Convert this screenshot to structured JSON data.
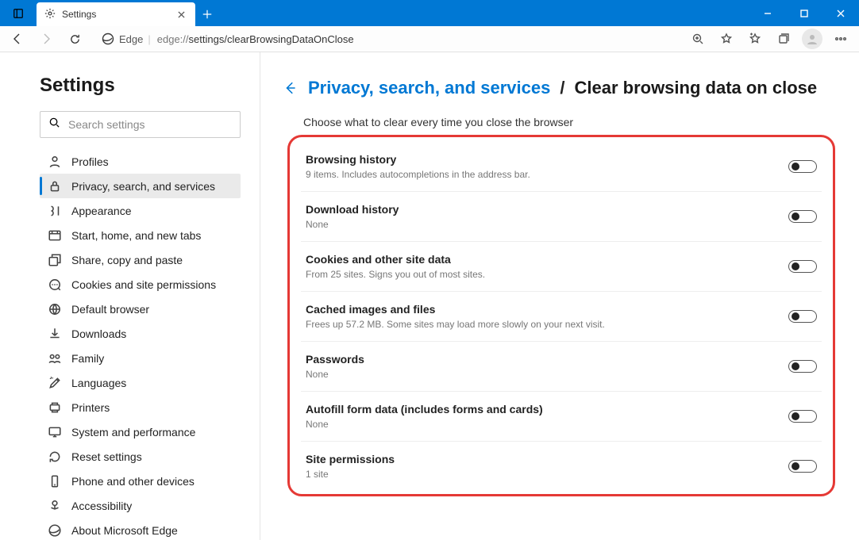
{
  "window": {
    "tab_title": "Settings"
  },
  "address": {
    "provider": "Edge",
    "url_prefix": "edge://",
    "url_path": "settings/clearBrowsingDataOnClose"
  },
  "sidebar": {
    "title": "Settings",
    "search_placeholder": "Search settings",
    "items": [
      {
        "label": "Profiles"
      },
      {
        "label": "Privacy, search, and services"
      },
      {
        "label": "Appearance"
      },
      {
        "label": "Start, home, and new tabs"
      },
      {
        "label": "Share, copy and paste"
      },
      {
        "label": "Cookies and site permissions"
      },
      {
        "label": "Default browser"
      },
      {
        "label": "Downloads"
      },
      {
        "label": "Family"
      },
      {
        "label": "Languages"
      },
      {
        "label": "Printers"
      },
      {
        "label": "System and performance"
      },
      {
        "label": "Reset settings"
      },
      {
        "label": "Phone and other devices"
      },
      {
        "label": "Accessibility"
      },
      {
        "label": "About Microsoft Edge"
      }
    ],
    "active_index": 1
  },
  "content": {
    "crumb_link": "Privacy, search, and services",
    "crumb_sep": "/",
    "crumb_current": "Clear browsing data on close",
    "subtitle": "Choose what to clear every time you close the browser",
    "options": [
      {
        "title": "Browsing history",
        "desc": "9 items. Includes autocompletions in the address bar.",
        "on": false
      },
      {
        "title": "Download history",
        "desc": "None",
        "on": false
      },
      {
        "title": "Cookies and other site data",
        "desc": "From 25 sites. Signs you out of most sites.",
        "on": false
      },
      {
        "title": "Cached images and files",
        "desc": "Frees up 57.2 MB. Some sites may load more slowly on your next visit.",
        "on": false
      },
      {
        "title": "Passwords",
        "desc": "None",
        "on": false
      },
      {
        "title": "Autofill form data (includes forms and cards)",
        "desc": "None",
        "on": false
      },
      {
        "title": "Site permissions",
        "desc": "1 site",
        "on": false
      }
    ]
  }
}
